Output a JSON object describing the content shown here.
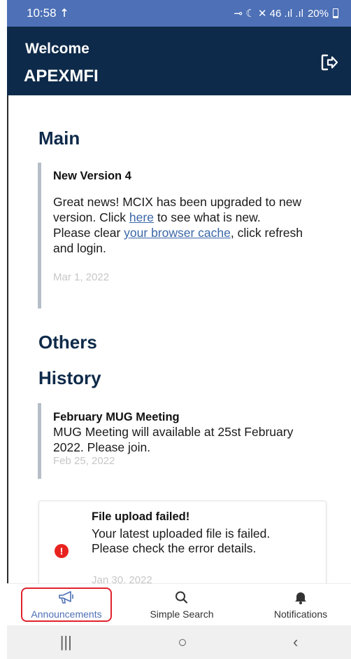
{
  "status_bar": {
    "time": "10:58",
    "indicators": "⊸ ☾ ✕ 46 .ıl .ıl",
    "battery": "20%"
  },
  "header": {
    "welcome": "Welcome",
    "company": "APEXMFI",
    "logout_icon": "logout-icon"
  },
  "main": {
    "title": "Main",
    "announcement": {
      "title": "New Version 4",
      "body_1": "Great news! MCIX has been upgraded to new version. Click ",
      "link_here": "here",
      "body_2": " to see what is new.",
      "body_3": "Please clear ",
      "link_cache": "your browser cache",
      "body_4": ", click refresh and login.",
      "date": "Mar 1, 2022"
    }
  },
  "others": {
    "title": "Others"
  },
  "history": {
    "title": "History",
    "item": {
      "title": "February MUG Meeting",
      "body": "MUG Meeting will available at 25st February 2022. Please join.",
      "date": "Feb 25, 2022"
    }
  },
  "notification_card": {
    "title": "File upload failed!",
    "body": "Your latest uploaded file is failed. Please check the error details.",
    "date": "Jan 30, 2022",
    "icon": "error-icon"
  },
  "bottom_nav": {
    "items": [
      {
        "label": "Announcements",
        "icon": "megaphone-icon",
        "active": true
      },
      {
        "label": "Simple Search",
        "icon": "search-icon",
        "active": false
      },
      {
        "label": "Notifications",
        "icon": "bell-icon",
        "active": false
      }
    ]
  },
  "system_nav": {
    "recents": "|||",
    "home": "○",
    "back": "‹"
  },
  "colors": {
    "header_bg": "#0e2a4a",
    "status_bg": "#4d70b6",
    "accent": "#4d70b6",
    "title": "#0e2a4a",
    "error": "#e8231f"
  }
}
